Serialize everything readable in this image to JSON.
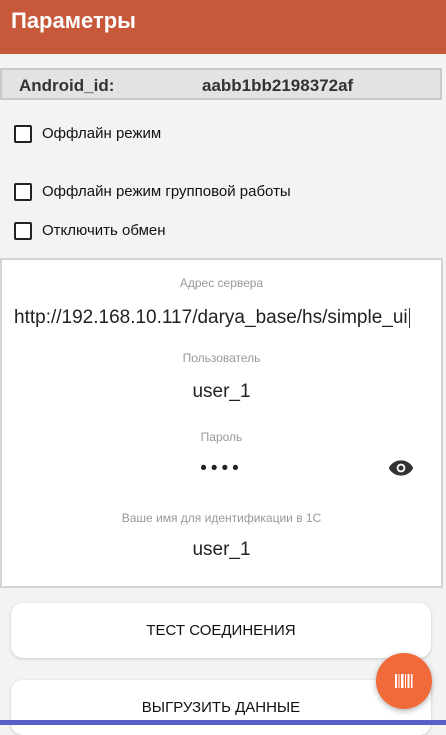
{
  "appbar": {
    "title": "Параметры"
  },
  "android_id": {
    "label": "Android_id:",
    "value": "aabb1bb2198372af"
  },
  "options": [
    {
      "label": "Оффлайн режим",
      "checked": false
    },
    {
      "label": "Оффлайн режим групповой работы",
      "checked": false
    },
    {
      "label": "Отключить обмен",
      "checked": false
    }
  ],
  "connection": {
    "server_caption": "Адрес сервера",
    "server_value": "http://192.168.10.117/darya_base/hs/simple_ui",
    "user_caption": "Пользователь",
    "user_value": "user_1",
    "password_caption": "Пароль",
    "password_value": "••••",
    "ident_caption": "Ваше имя для идентификации в 1С",
    "ident_value": "user_1"
  },
  "buttons": {
    "test": "ТЕСТ СОЕДИНЕНИЯ",
    "upload": "ВЫГРУЗИТЬ ДАННЫЕ"
  },
  "icons": {
    "password_toggle": "eye-icon",
    "fab": "barcode-icon"
  },
  "colors": {
    "appbar": "#c7583a",
    "fab": "#f06a3a",
    "nav_accent": "#5a5fc8"
  }
}
